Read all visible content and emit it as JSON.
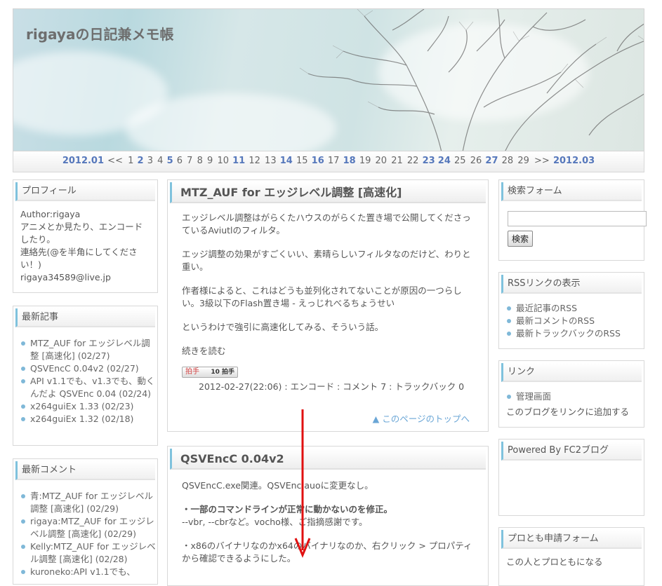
{
  "site": {
    "title": "rigayaの日記兼メモ帳"
  },
  "calendar": {
    "prev_month": "2012.01",
    "prev_sep": "<<",
    "next_sep": ">>",
    "next_month": "2012.03",
    "days": [
      {
        "d": "1",
        "link": false
      },
      {
        "d": "2",
        "link": true
      },
      {
        "d": "3",
        "link": false
      },
      {
        "d": "4",
        "link": false
      },
      {
        "d": "5",
        "link": true
      },
      {
        "d": "6",
        "link": false
      },
      {
        "d": "7",
        "link": false
      },
      {
        "d": "8",
        "link": false
      },
      {
        "d": "9",
        "link": false
      },
      {
        "d": "10",
        "link": false
      },
      {
        "d": "11",
        "link": true
      },
      {
        "d": "12",
        "link": false
      },
      {
        "d": "13",
        "link": false
      },
      {
        "d": "14",
        "link": true
      },
      {
        "d": "15",
        "link": false
      },
      {
        "d": "16",
        "link": true
      },
      {
        "d": "17",
        "link": false
      },
      {
        "d": "18",
        "link": true
      },
      {
        "d": "19",
        "link": false
      },
      {
        "d": "20",
        "link": false
      },
      {
        "d": "21",
        "link": false
      },
      {
        "d": "22",
        "link": false
      },
      {
        "d": "23",
        "link": true
      },
      {
        "d": "24",
        "link": true
      },
      {
        "d": "25",
        "link": false
      },
      {
        "d": "26",
        "link": false
      },
      {
        "d": "27",
        "link": true
      },
      {
        "d": "28",
        "link": false
      },
      {
        "d": "29",
        "link": false
      }
    ]
  },
  "profile": {
    "title": "プロフィール",
    "lines": [
      "Author:rigaya",
      "アニメとか見たり、エンコードしたり。",
      "連絡先(@を半角にしてください！)",
      "rigaya34589@live.jp"
    ]
  },
  "recent_entries": {
    "title": "最新記事",
    "items": [
      "MTZ_AUF for エッジレベル調整 [高速化] (02/27)",
      "QSVEncC 0.04v2 (02/27)",
      "API v1.1でも、v1.3でも、動くんだよ QSVEnc 0.04 (02/24)",
      "x264guiEx 1.33 (02/23)",
      "x264guiEx 1.32 (02/18)"
    ]
  },
  "recent_comments": {
    "title": "最新コメント",
    "items": [
      "青:MTZ_AUF for エッジレベル調整 [高速化] (02/29)",
      "rigaya:MTZ_AUF for エッジレベル調整 [高速化] (02/29)",
      "Kelly:MTZ_AUF for エッジレベル調整 [高速化] (02/28)",
      "kuroneko:API v1.1でも、"
    ]
  },
  "entry1": {
    "title": "MTZ_AUF for エッジレベル調整 [高速化]",
    "p1_a": "エッジレベル調整は",
    "p1_link": "がらくたハウスのがらくた置き場",
    "p1_b": "で公開してくださっているAviutlのフィルタ。",
    "p2": "エッジ調整の効果がすごくいい、素晴らしいフィルタなのだけど、わりと重い。",
    "p3_a": "作者様によると、これはどうも並列化されてないことが原因の一つらしい。",
    "p3_link": "3級以下のFlash置き場 - えっじれべるちょうせい",
    "p4": "というわけで強引に高速化してみる、そういう話。",
    "more": "続きを読む",
    "clap_hand": "拍手",
    "clap_count": "10",
    "clap_unit": "拍手",
    "footer": "2012-02-27(22:06) : エンコード : コメント 7 : トラックバック 0",
    "pagetop": "▲ このページのトップへ"
  },
  "entry2": {
    "title": "QSVEncC 0.04v2",
    "p1": "QSVEncC.exe関連。QSVEnc.auoに変更なし。",
    "p2_bold": "・一部のコマンドラインが正常に動かないのを修正。",
    "p2_rest": "--vbr, --cbrなど。vocho様、ご指摘感謝です。",
    "p3": "・x86のバイナリなのかx64のバイナリなのか、右クリック > プロパティから確認できるようにした。"
  },
  "search": {
    "title": "検索フォーム",
    "placeholder": "",
    "button": "検索"
  },
  "rss": {
    "title": "RSSリンクの表示",
    "items": [
      "最近記事のRSS",
      "最新コメントのRSS",
      "最新トラックバックのRSS"
    ]
  },
  "links": {
    "title": "リンク",
    "items": [
      "管理画面"
    ],
    "add": "このブログをリンクに追加する"
  },
  "powered": {
    "title": "Powered By FC2ブログ"
  },
  "protomo": {
    "title": "プロとも申請フォーム",
    "text": "この人とプロともになる"
  },
  "colors": {
    "accent": "#7fc2dd",
    "link_blue": "#5577bb",
    "arrow": "#e01010"
  }
}
